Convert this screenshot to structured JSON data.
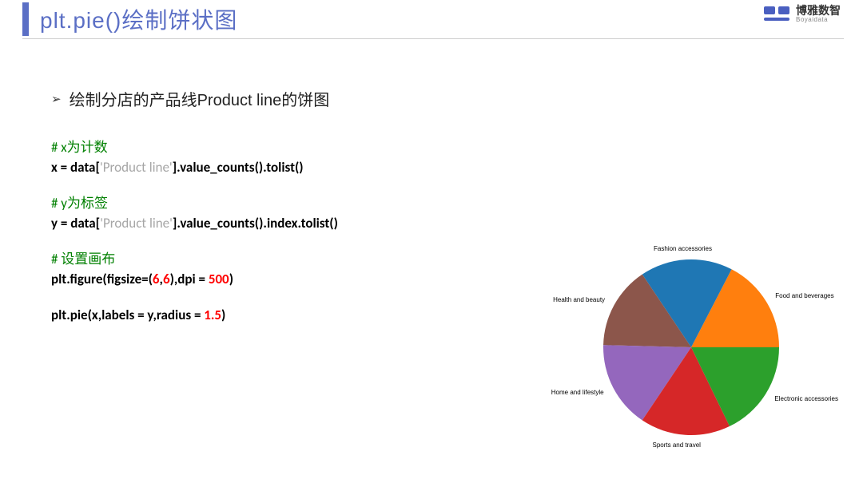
{
  "header": {
    "title": "plt.pie()绘制饼状图",
    "logo_cn": "博雅数智",
    "logo_en": "Boyaidata"
  },
  "bullet": "绘制分店的产品线Product line的饼图",
  "code": {
    "c1": "# x为计数",
    "l1a": "x = data[",
    "l1s": "'Product line'",
    "l1b": "].value_counts().tolist()",
    "c2": "# y为标签",
    "l2a": "y = data[",
    "l2s": "'Product line'",
    "l2b": "].value_counts().index.tolist()",
    "c3": "# 设置画布",
    "l3a": "plt.figure(figsize=(",
    "l3n1": "6",
    "l3m": ",",
    "l3n2": "6",
    "l3b": "),dpi = ",
    "l3n3": "500",
    "l3c": ")",
    "l4a": "plt.pie(x,labels = y,radius = ",
    "l4n": "1.5",
    "l4b": ")"
  },
  "chart_data": {
    "type": "pie",
    "title": "",
    "categories": [
      "Food and beverages",
      "Fashion accessories",
      "Health and beauty",
      "Home and lifestyle",
      "Sports and travel",
      "Electronic accessories"
    ],
    "values": [
      17.4,
      17.0,
      15.2,
      16.0,
      16.6,
      17.8
    ],
    "colors": [
      "#ff7f0e",
      "#1f77b4",
      "#8c564b",
      "#9467bd",
      "#d62728",
      "#2ca02c"
    ]
  }
}
